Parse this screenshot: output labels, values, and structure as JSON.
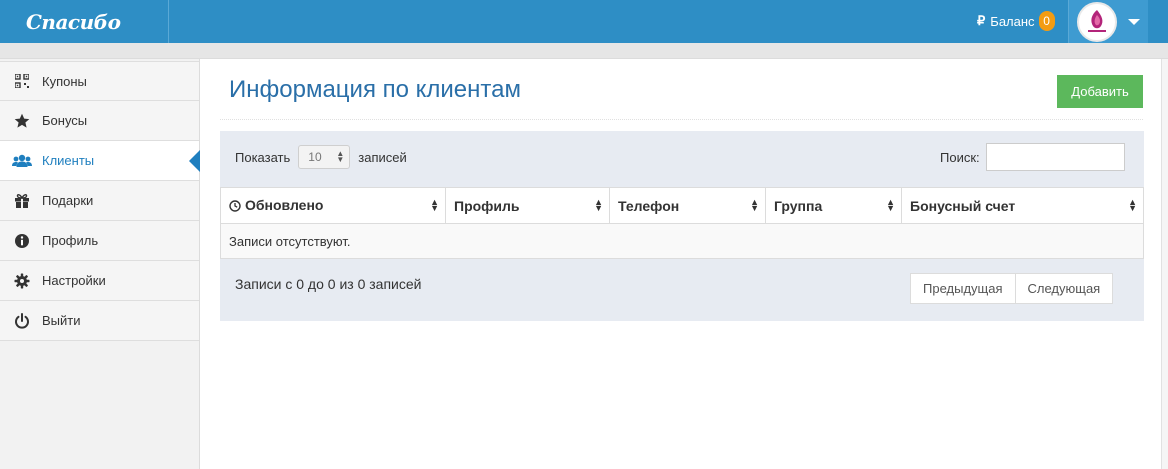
{
  "header": {
    "logo": "Спасибо",
    "balance_currency": "₽",
    "balance_label": "Баланс",
    "balance_count": "0"
  },
  "sidebar": {
    "items": [
      {
        "label": "Купоны",
        "icon": "qrcode-icon"
      },
      {
        "label": "Бонусы",
        "icon": "star-icon"
      },
      {
        "label": "Клиенты",
        "icon": "users-icon",
        "active": true
      },
      {
        "label": "Подарки",
        "icon": "gift-icon"
      },
      {
        "label": "Профиль",
        "icon": "info-icon"
      },
      {
        "label": "Настройки",
        "icon": "gear-icon"
      },
      {
        "label": "Выйти",
        "icon": "power-icon"
      }
    ]
  },
  "main": {
    "title": "Информация по клиентам",
    "add_label": "Добавить",
    "show_label": "Показать",
    "page_size": "10",
    "records_label": "записей",
    "search_label": "Поиск:",
    "search_value": "",
    "columns": [
      "Обновлено",
      "Профиль",
      "Телефон",
      "Группа",
      "Бонусный счет"
    ],
    "empty_text": "Записи отсутствуют.",
    "info_text": "Записи с 0 до 0 из 0 записей",
    "prev_label": "Предыдущая",
    "next_label": "Следующая"
  },
  "colors": {
    "topbar": "#2e8ec5",
    "accent": "#1f7fbf",
    "add_button": "#5cb85c",
    "badge": "#f39c12"
  }
}
